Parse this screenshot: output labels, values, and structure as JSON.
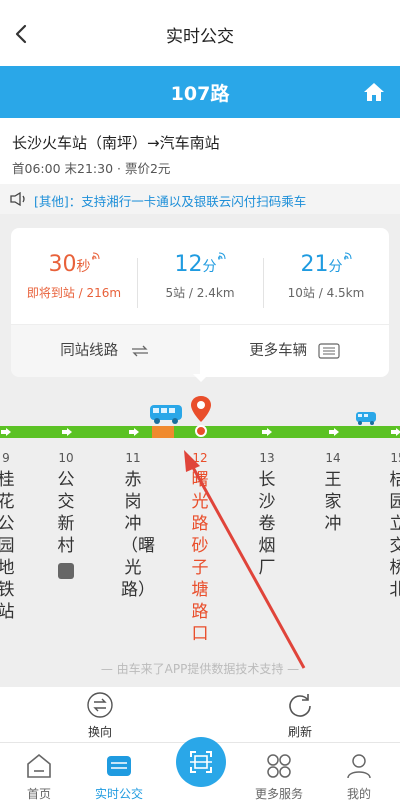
{
  "nav": {
    "title": "实时公交"
  },
  "route": {
    "name": "107路"
  },
  "info": {
    "direction": "长沙火车站（南坪）→汽车南站",
    "meta": "首06:00 末21:30 · 票价2元"
  },
  "notice": {
    "text": "[其他]：支持湘行一卡通以及银联云闪付扫码乘车"
  },
  "eta": [
    {
      "value": "30",
      "unit": "秒",
      "sub": "即将到站 / 216m",
      "color": "#e8613a"
    },
    {
      "value": "12",
      "unit": "分",
      "sub": "5站 / 2.4km",
      "color": "#1f9be0"
    },
    {
      "value": "21",
      "unit": "分",
      "sub": "10站 / 4.5km",
      "color": "#1f9be0"
    }
  ],
  "tabs": {
    "same_station": "同站线路",
    "more_buses": "更多车辆"
  },
  "stations": [
    {
      "num": "9",
      "name": "桂花公园地铁站"
    },
    {
      "num": "10",
      "name": "公交新村"
    },
    {
      "num": "11",
      "name": "赤岗冲（曙光路）"
    },
    {
      "num": "12",
      "name": "曙光路砂子塘路口"
    },
    {
      "num": "13",
      "name": "长沙卷烟厂"
    },
    {
      "num": "14",
      "name": "王家冲"
    },
    {
      "num": "15",
      "name": "桔园立交桥北"
    }
  ],
  "footer_note": "— 由车来了APP提供数据技术支持 —",
  "actions": {
    "reverse": "换向",
    "refresh": "刷新"
  },
  "tabbar": {
    "home": "首页",
    "realtime": "实时公交",
    "more": "更多服务",
    "mine": "我的"
  },
  "colors": {
    "accent": "#2aa7e8",
    "track": "#5bc224",
    "current": "#e94e2b"
  }
}
